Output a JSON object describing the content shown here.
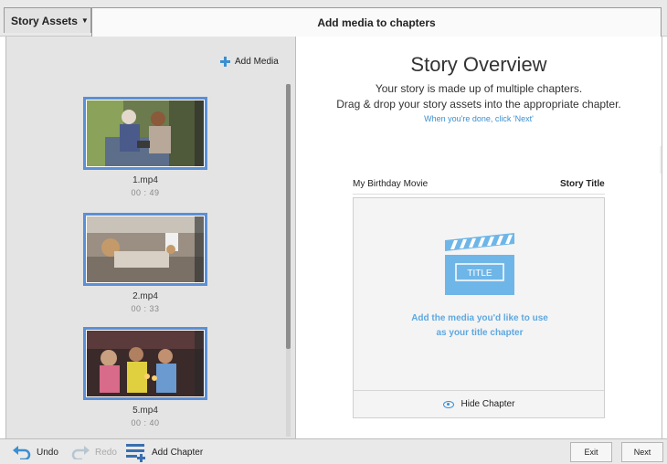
{
  "header": {
    "assets_tab": "Story Assets",
    "title": "Add media to chapters"
  },
  "left_panel": {
    "add_media_label": "Add Media",
    "media": [
      {
        "name": "1.mp4",
        "duration": "00 : 49"
      },
      {
        "name": "2.mp4",
        "duration": "00 : 33"
      },
      {
        "name": "5.mp4",
        "duration": "00 : 40"
      }
    ]
  },
  "overview": {
    "title": "Story Overview",
    "line1": "Your story is made up of multiple chapters.",
    "line2": "Drag & drop your story assets into the appropriate chapter.",
    "hint": "When you're done, click 'Next'",
    "story_name": "My Birthday Movie",
    "story_label": "Story Title",
    "chapter": {
      "clap_label": "TITLE",
      "line1": "Add the media you'd like to use",
      "line2": "as your title chapter",
      "hide_label": "Hide Chapter"
    }
  },
  "footer": {
    "undo": "Undo",
    "redo": "Redo",
    "add_chapter": "Add Chapter",
    "exit": "Exit",
    "next": "Next"
  },
  "colors": {
    "accent": "#3a8fd0",
    "thumb_border": "#5b8fd6",
    "clapper": "#6fb6e8"
  }
}
